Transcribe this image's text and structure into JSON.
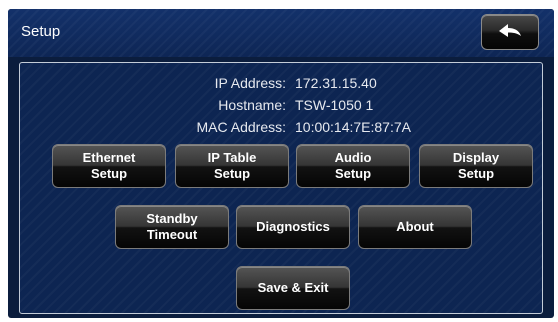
{
  "header": {
    "title": "Setup",
    "back_icon": "back-arrow-icon"
  },
  "info": [
    {
      "label": "IP Address:",
      "value": "172.31.15.40"
    },
    {
      "label": "Hostname:",
      "value": "TSW-1050 1"
    },
    {
      "label": "MAC Address:",
      "value": "10:00:14:7E:87:7A"
    }
  ],
  "buttons": {
    "ethernet": {
      "line1": "Ethernet",
      "line2": "Setup"
    },
    "ip_table": {
      "line1": "IP Table",
      "line2": "Setup"
    },
    "audio": {
      "line1": "Audio",
      "line2": "Setup"
    },
    "display": {
      "line1": "Display",
      "line2": "Setup"
    },
    "standby": {
      "line1": "Standby",
      "line2": "Timeout"
    },
    "diagnostics": {
      "label": "Diagnostics"
    },
    "about": {
      "label": "About"
    },
    "save_exit": {
      "label": "Save & Exit"
    }
  },
  "colors": {
    "background": "#0b1d3d",
    "title_bar": "#13316a",
    "panel": "#0d2552",
    "button": "#1a1a1a",
    "text": "#ffffff"
  }
}
